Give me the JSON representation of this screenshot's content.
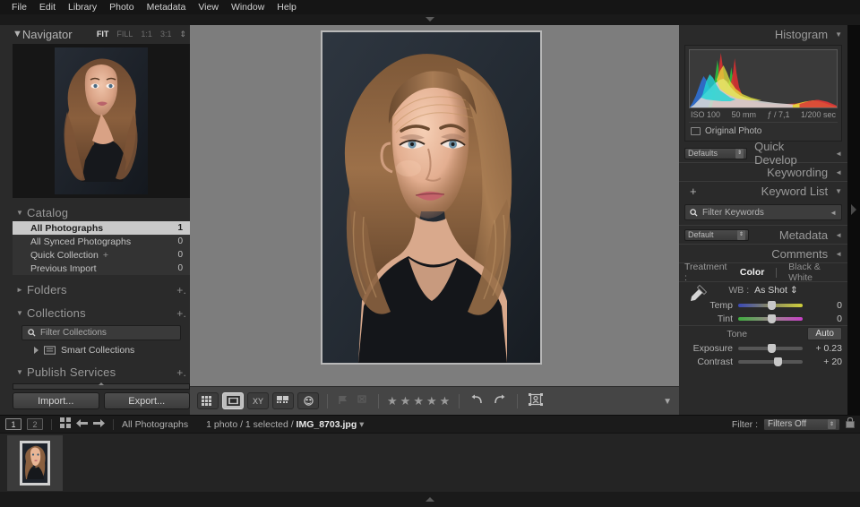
{
  "menubar": {
    "items": [
      "File",
      "Edit",
      "Library",
      "Photo",
      "Metadata",
      "View",
      "Window",
      "Help"
    ]
  },
  "left_panel": {
    "navigator": {
      "title": "Navigator",
      "twisty": "▼",
      "zoom_options": [
        "FIT",
        "FILL",
        "1:1",
        "3:1"
      ],
      "zoom_selected": "FIT",
      "stepper": "⇕"
    },
    "catalog": {
      "title": "Catalog",
      "twisty": "▼",
      "rows": [
        {
          "label": "All Photographs",
          "count": "1",
          "selected": true,
          "plus": ""
        },
        {
          "label": "All Synced Photographs",
          "count": "0",
          "selected": false,
          "plus": ""
        },
        {
          "label": "Quick Collection",
          "count": "0",
          "selected": false,
          "plus": "+"
        },
        {
          "label": "Previous Import",
          "count": "0",
          "selected": false,
          "plus": ""
        }
      ]
    },
    "folders": {
      "title": "Folders",
      "twisty": "►",
      "plus": "+."
    },
    "collections": {
      "title": "Collections",
      "twisty": "▼",
      "plus": "+.",
      "filter_placeholder": "Filter Collections",
      "smart_collections": "Smart Collections"
    },
    "publish_services": {
      "title": "Publish Services",
      "twisty": "▼",
      "plus": "+."
    },
    "import_label": "Import...",
    "export_label": "Export..."
  },
  "toolbar": {
    "view_grid": "grid-view",
    "view_loupe": "loupe-view",
    "view_compare": "XY",
    "view_survey": "survey-view",
    "view_people": "people-view",
    "flag_pick": "flag",
    "flag_reject": "x",
    "stars": [
      "★",
      "★",
      "★",
      "★",
      "★"
    ],
    "rotate_left": "↰",
    "rotate_right": "↵",
    "crop": "crop-overlay",
    "collapse": "▼"
  },
  "right_panel": {
    "histogram": {
      "title": "Histogram",
      "twisty": "▼",
      "iso": "ISO 100",
      "focal": "50 mm",
      "aperture": "ƒ / 7,1",
      "shutter": "1/200 sec",
      "original_photo": "Original Photo"
    },
    "quick_develop": {
      "title": "Quick Develop",
      "twisty": "◄",
      "preset_selected": "Defaults",
      "treatment_label": "Treatment :",
      "treatment_color": "Color",
      "treatment_bw": "Black & White",
      "wb_label": "WB :",
      "wb_value": "As Shot ⇕",
      "sliders": [
        {
          "name": "Temp",
          "value": "0",
          "knob_pct": 50,
          "gradient": "linear-gradient(90deg,#3a49b8,#7d7d60,#cfcf3a)"
        },
        {
          "name": "Tint",
          "value": "0",
          "knob_pct": 50,
          "gradient": "linear-gradient(90deg,#3fae3f,#8a8a8a,#c83fc8)"
        }
      ],
      "tone_label": "Tone",
      "auto_label": "Auto",
      "tone_sliders": [
        {
          "name": "Exposure",
          "value": "+ 0.23",
          "knob_pct": 48
        },
        {
          "name": "Contrast",
          "value": "+ 20",
          "knob_pct": 56
        }
      ]
    },
    "keywording": {
      "title": "Keywording",
      "twisty": "◄"
    },
    "keyword_list": {
      "title": "Keyword List",
      "twisty": "▼",
      "plus": "+",
      "filter_placeholder": "Filter Keywords",
      "collapse": "◄"
    },
    "metadata": {
      "title": "Metadata",
      "twisty": "◄",
      "preset_selected": "Default"
    },
    "comments": {
      "title": "Comments",
      "twisty": "◄"
    }
  },
  "filmstrip_bar": {
    "screen1": "1",
    "screen2": "2",
    "grid_icon": "grid-icon",
    "back_arrow": "←",
    "forward_arrow": "→",
    "source": "All Photographs",
    "status_prefix": "1 photo / 1 selected /",
    "filename": "IMG_8703.jpg",
    "status_caret": "▾",
    "filter_label": "Filter :",
    "filter_value": "Filters Off",
    "filter_stepper": "⇕",
    "lock_icon": "lock-icon"
  },
  "content_bar": {
    "status_prefix": "1 photo / 1 selected /",
    "filename": "IMG_8703.jpg",
    "caret": "▾"
  },
  "colors": {
    "panel_bg": "#2a2a2a",
    "center_bg": "#7d7d7d",
    "selection": "#c9c9c9",
    "text": "#b4b4b4",
    "photo_bg": "#2b333d"
  }
}
